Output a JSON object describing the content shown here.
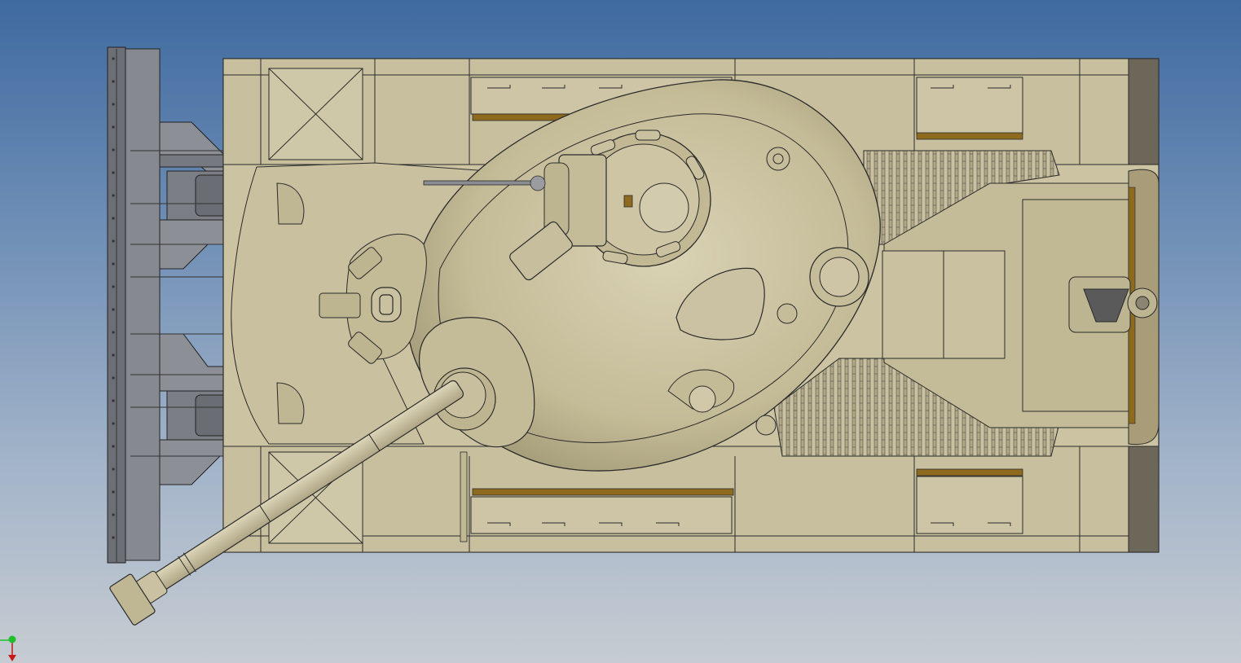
{
  "viewport": {
    "background_top": "#3f6aa0",
    "background_bottom": "#c6ccd2"
  },
  "model": {
    "hull_color": "#cbc3a2",
    "hull_shade": "#b8af8b",
    "turret_color": "#c8bf9c",
    "mechanism_color": "#7d7f83",
    "detail_color": "#8e6a1f",
    "line_color": "#2b2b2b"
  },
  "triad": {
    "y_axis_color": "#1fbf2c",
    "z_axis_color": "#c81818"
  }
}
